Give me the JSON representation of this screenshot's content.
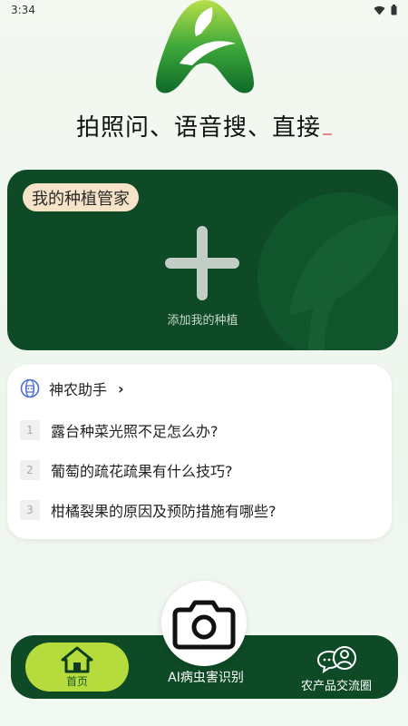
{
  "status_bar": {
    "time": "3:34"
  },
  "slogan": "拍照问、语音搜、直接",
  "plant_card": {
    "badge": "我的种植管家",
    "add_label": "添加我的种植"
  },
  "assistant": {
    "title": "神农助手",
    "questions": [
      {
        "num": "1",
        "text": "露台种菜光照不足怎么办?"
      },
      {
        "num": "2",
        "text": "葡萄的疏花疏果有什么技巧?"
      },
      {
        "num": "3",
        "text": "柑橘裂果的原因及预防措施有哪些?"
      }
    ]
  },
  "bottom_nav": {
    "home_label": "首页",
    "ai_label": "AI病虫害识别",
    "community_label": "农产品交流圈"
  },
  "colors": {
    "dark_green": "#0d4a25",
    "lime": "#b5dc3c",
    "badge_bg": "#f7e3c8"
  },
  "icons": {
    "logo": "leaf-logo",
    "add": "plus-icon",
    "assistant": "assistant-globe-icon",
    "home": "home-icon",
    "camera": "camera-icon",
    "community": "community-chat-icon"
  }
}
